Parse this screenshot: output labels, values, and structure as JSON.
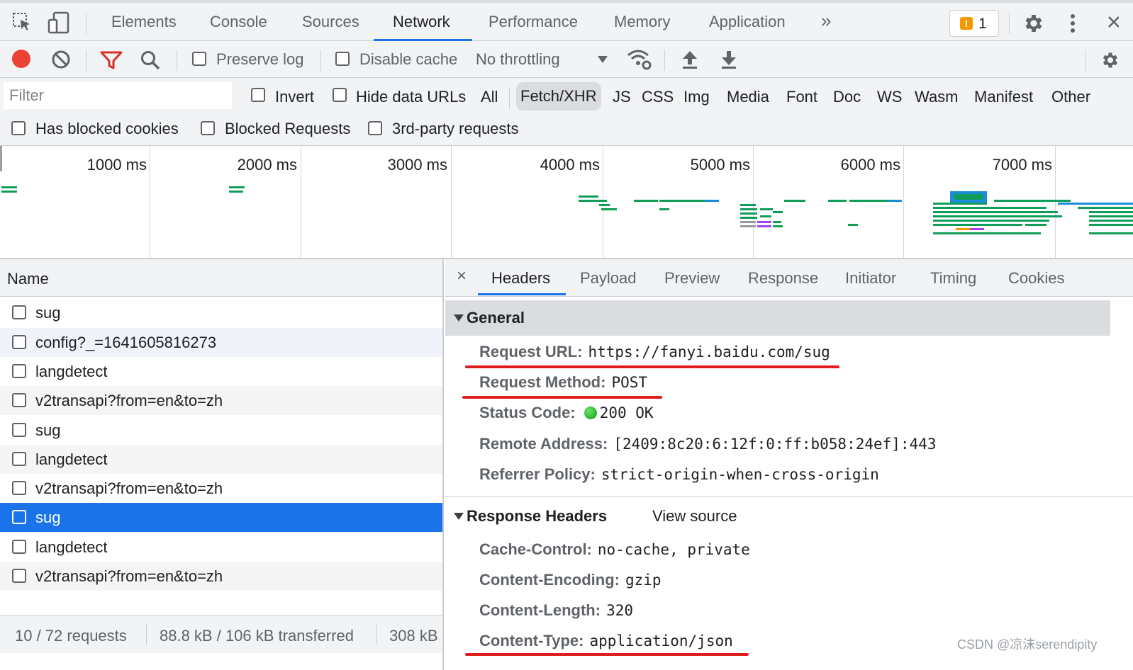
{
  "tabs": [
    "Elements",
    "Console",
    "Sources",
    "Network",
    "Performance",
    "Memory",
    "Application"
  ],
  "active_tab": "Network",
  "issues_count": "1",
  "toolbar": {
    "preserve_log": "Preserve log",
    "disable_cache": "Disable cache",
    "throttling": "No throttling"
  },
  "filter": {
    "placeholder": "Filter",
    "invert": "Invert",
    "hide_data_urls": "Hide data URLs",
    "types": [
      "All",
      "Fetch/XHR",
      "JS",
      "CSS",
      "Img",
      "Media",
      "Font",
      "Doc",
      "WS",
      "Wasm",
      "Manifest",
      "Other"
    ],
    "selected_type": "Fetch/XHR",
    "has_blocked_cookies": "Has blocked cookies",
    "blocked_requests": "Blocked Requests",
    "third_party": "3rd-party requests"
  },
  "overview": {
    "ticks": [
      "1000 ms",
      "2000 ms",
      "3000 ms",
      "4000 ms",
      "5000 ms",
      "6000 ms",
      "7000 ms"
    ]
  },
  "requests": {
    "header": "Name",
    "rows": [
      "sug",
      "config?_=1641605816273",
      "langdetect",
      "v2transapi?from=en&to=zh",
      "sug",
      "langdetect",
      "v2transapi?from=en&to=zh",
      "sug",
      "langdetect",
      "v2transapi?from=en&to=zh"
    ],
    "selected_index": 7,
    "status": {
      "requests": "10 / 72 requests",
      "transferred": "88.8 kB / 106 kB transferred",
      "resources": "308 kB"
    }
  },
  "details": {
    "tabs": [
      "Headers",
      "Payload",
      "Preview",
      "Response",
      "Initiator",
      "Timing",
      "Cookies"
    ],
    "active_tab": "Headers",
    "general": {
      "title": "General",
      "request_url_label": "Request URL:",
      "request_url": "https://fanyi.baidu.com/sug",
      "request_method_label": "Request Method:",
      "request_method": "POST",
      "status_code_label": "Status Code:",
      "status_code": "200 OK",
      "remote_address_label": "Remote Address:",
      "remote_address": "[2409:8c20:6:12f:0:ff:b058:24ef]:443",
      "referrer_policy_label": "Referrer Policy:",
      "referrer_policy": "strict-origin-when-cross-origin"
    },
    "response_headers": {
      "title": "Response Headers",
      "view_source": "View source",
      "cache_control_label": "Cache-Control:",
      "cache_control": "no-cache, private",
      "content_encoding_label": "Content-Encoding:",
      "content_encoding": "gzip",
      "content_length_label": "Content-Length:",
      "content_length": "320",
      "content_type_label": "Content-Type:",
      "content_type": "application/json"
    }
  },
  "watermark": "CSDN @凉沫serendipity",
  "colors": {
    "accent": "#1a73e8",
    "record": "#ea4335",
    "waterfall": "#0f9d58",
    "annotation": "#e11c1c"
  }
}
